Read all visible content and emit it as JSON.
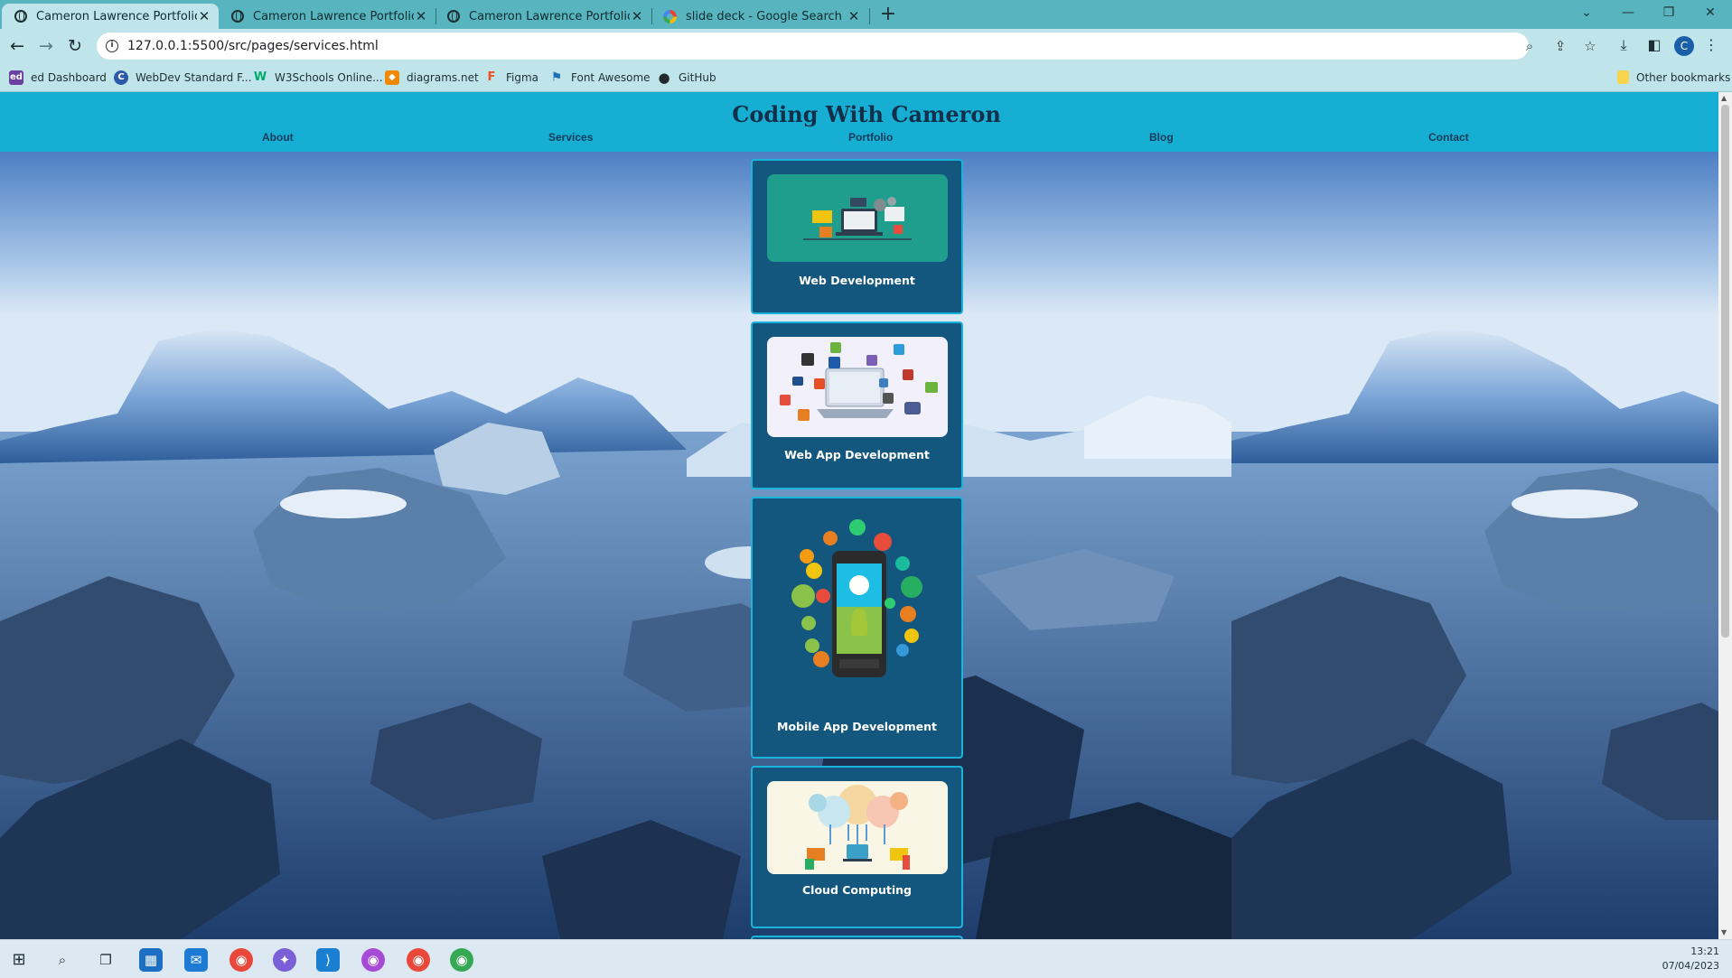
{
  "browser": {
    "tabs": [
      {
        "title": "Cameron Lawrence Portfolio",
        "active": true,
        "icon": "globe-icon"
      },
      {
        "title": "Cameron Lawrence Portfolio",
        "active": false,
        "icon": "globe-icon"
      },
      {
        "title": "Cameron Lawrence Portfolio",
        "active": false,
        "icon": "globe-icon"
      },
      {
        "title": "slide deck - Google Search",
        "active": false,
        "icon": "google-icon"
      }
    ],
    "new_tab": "+",
    "url": "127.0.0.1:5500/src/pages/services.html",
    "profile_initial": "C",
    "bookmarks": [
      {
        "label": "ed Dashboard",
        "icon": "ed-icon",
        "icon_text": "ed",
        "color": "#6b3fa0"
      },
      {
        "label": "WebDev Standard F...",
        "icon": "webdev-icon",
        "icon_text": "C",
        "color": "#2d5aa8"
      },
      {
        "label": "W3Schools Online...",
        "icon": "w3schools-icon",
        "icon_text": "W",
        "color": "#04aa6d"
      },
      {
        "label": "diagrams.net",
        "icon": "diagrams-icon",
        "icon_text": "◆",
        "color": "#f08705"
      },
      {
        "label": "Figma",
        "icon": "figma-icon",
        "icon_text": "F",
        "color": "#f24e1e"
      },
      {
        "label": "Font Awesome",
        "icon": "flag-icon",
        "icon_text": "⚑",
        "color": "#1d6fb8"
      },
      {
        "label": "GitHub",
        "icon": "github-icon",
        "icon_text": "●",
        "color": "#24292e"
      }
    ],
    "other_bookmarks": "Other bookmarks"
  },
  "site": {
    "title": "Coding With Cameron",
    "nav": [
      "About",
      "Services",
      "Portfolio",
      "Blog",
      "Contact"
    ],
    "services": [
      {
        "label": "Web Development",
        "image": "web-development-illustration"
      },
      {
        "label": "Web App Development",
        "image": "web-app-development-illustration"
      },
      {
        "label": "Mobile App Development",
        "image": "mobile-app-development-illustration"
      },
      {
        "label": "Cloud Computing",
        "image": "cloud-computing-illustration"
      }
    ],
    "colors": {
      "header": "#16afd3",
      "card": "#14577e",
      "card_border": "#1ab3dc"
    }
  },
  "taskbar": {
    "time": "13:21",
    "date": "07/04/2023"
  }
}
